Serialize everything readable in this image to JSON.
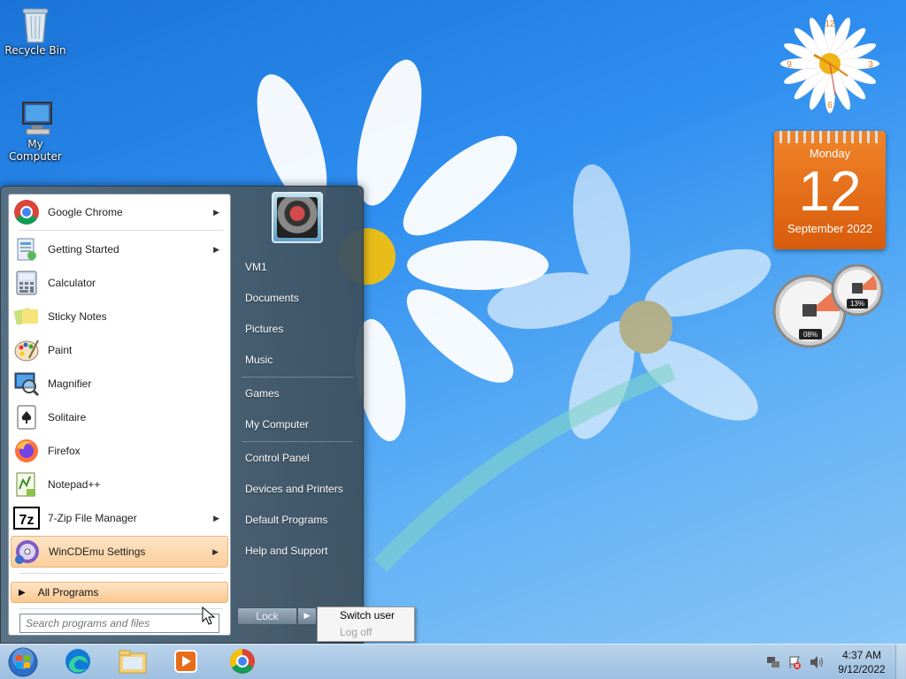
{
  "desktop": {
    "icons": [
      {
        "label": "Recycle Bin",
        "icon": "recycle-bin-icon"
      },
      {
        "label": "My Computer",
        "icon": "computer-icon"
      }
    ]
  },
  "gadgets": {
    "calendar": {
      "day_name": "Monday",
      "day_number": "12",
      "month_year": "September 2022"
    },
    "meter": {
      "cpu_percent": "08%",
      "memory_percent": "13%"
    },
    "clock": {
      "numerals": [
        "12",
        "3",
        "6",
        "9"
      ]
    }
  },
  "start_menu": {
    "programs": [
      {
        "label": "Google Chrome",
        "icon": "chrome-icon",
        "has_submenu": true
      },
      {
        "label": "Getting Started",
        "icon": "getting-started-icon",
        "has_submenu": true
      },
      {
        "label": "Calculator",
        "icon": "calculator-icon",
        "has_submenu": false
      },
      {
        "label": "Sticky Notes",
        "icon": "sticky-notes-icon",
        "has_submenu": false
      },
      {
        "label": "Paint",
        "icon": "paint-icon",
        "has_submenu": false
      },
      {
        "label": "Magnifier",
        "icon": "magnifier-icon",
        "has_submenu": false
      },
      {
        "label": "Solitaire",
        "icon": "solitaire-icon",
        "has_submenu": false
      },
      {
        "label": "Firefox",
        "icon": "firefox-icon",
        "has_submenu": false
      },
      {
        "label": "Notepad++",
        "icon": "notepad-plus-plus-icon",
        "has_submenu": false
      },
      {
        "label": "7-Zip File Manager",
        "icon": "7zip-icon",
        "has_submenu": true
      },
      {
        "label": "WinCDEmu Settings",
        "icon": "wincdemu-icon",
        "has_submenu": true
      }
    ],
    "all_programs_label": "All Programs",
    "search_placeholder": "Search programs and files",
    "right_items": [
      {
        "label": "VM1"
      },
      {
        "label": "Documents"
      },
      {
        "label": "Pictures"
      },
      {
        "label": "Music"
      },
      {
        "label": "Games"
      },
      {
        "label": "My Computer"
      },
      {
        "label": "Control Panel"
      },
      {
        "label": "Devices and Printers"
      },
      {
        "label": "Default Programs"
      },
      {
        "label": "Help and Support"
      }
    ],
    "lock_label": "Lock",
    "power_submenu": [
      {
        "label": "Switch user",
        "enabled": true
      },
      {
        "label": "Log off",
        "enabled": false
      }
    ]
  },
  "taskbar": {
    "pinned": [
      {
        "icon": "edge-icon"
      },
      {
        "icon": "file-explorer-icon"
      },
      {
        "icon": "media-player-icon"
      },
      {
        "icon": "chrome-icon"
      }
    ],
    "tray_icons": [
      "network-icon",
      "action-center-icon",
      "volume-icon"
    ],
    "time": "4:37 AM",
    "date": "9/12/2022"
  }
}
